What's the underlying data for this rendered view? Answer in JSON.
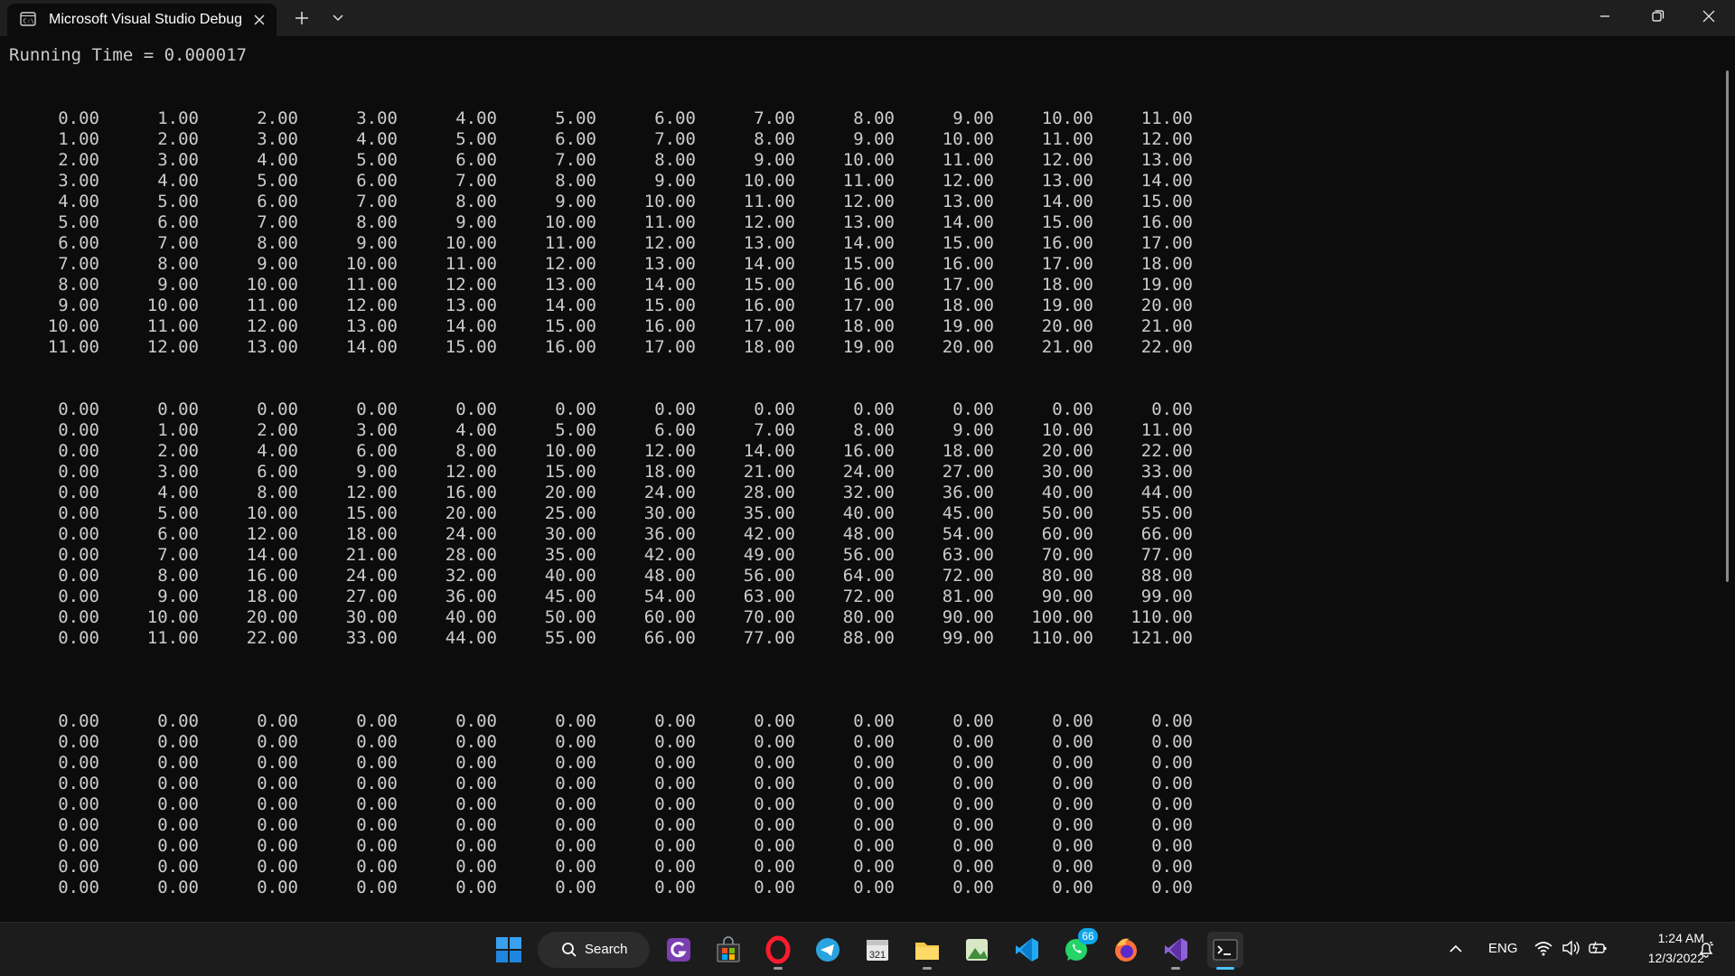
{
  "window": {
    "tab_title": "Microsoft Visual Studio Debug Console",
    "tab_icon": "terminal-icon",
    "buttons": [
      "minimize-icon",
      "restore-icon",
      "close-icon"
    ]
  },
  "console": {
    "running_time": "Running Time = 0.000017",
    "matrices": [
      {
        "rows": [
          [
            "0.00",
            "1.00",
            "2.00",
            "3.00",
            "4.00",
            "5.00",
            "6.00",
            "7.00",
            "8.00",
            "9.00",
            "10.00",
            "11.00"
          ],
          [
            "1.00",
            "2.00",
            "3.00",
            "4.00",
            "5.00",
            "6.00",
            "7.00",
            "8.00",
            "9.00",
            "10.00",
            "11.00",
            "12.00"
          ],
          [
            "2.00",
            "3.00",
            "4.00",
            "5.00",
            "6.00",
            "7.00",
            "8.00",
            "9.00",
            "10.00",
            "11.00",
            "12.00",
            "13.00"
          ],
          [
            "3.00",
            "4.00",
            "5.00",
            "6.00",
            "7.00",
            "8.00",
            "9.00",
            "10.00",
            "11.00",
            "12.00",
            "13.00",
            "14.00"
          ],
          [
            "4.00",
            "5.00",
            "6.00",
            "7.00",
            "8.00",
            "9.00",
            "10.00",
            "11.00",
            "12.00",
            "13.00",
            "14.00",
            "15.00"
          ],
          [
            "5.00",
            "6.00",
            "7.00",
            "8.00",
            "9.00",
            "10.00",
            "11.00",
            "12.00",
            "13.00",
            "14.00",
            "15.00",
            "16.00"
          ],
          [
            "6.00",
            "7.00",
            "8.00",
            "9.00",
            "10.00",
            "11.00",
            "12.00",
            "13.00",
            "14.00",
            "15.00",
            "16.00",
            "17.00"
          ],
          [
            "7.00",
            "8.00",
            "9.00",
            "10.00",
            "11.00",
            "12.00",
            "13.00",
            "14.00",
            "15.00",
            "16.00",
            "17.00",
            "18.00"
          ],
          [
            "8.00",
            "9.00",
            "10.00",
            "11.00",
            "12.00",
            "13.00",
            "14.00",
            "15.00",
            "16.00",
            "17.00",
            "18.00",
            "19.00"
          ],
          [
            "9.00",
            "10.00",
            "11.00",
            "12.00",
            "13.00",
            "14.00",
            "15.00",
            "16.00",
            "17.00",
            "18.00",
            "19.00",
            "20.00"
          ],
          [
            "10.00",
            "11.00",
            "12.00",
            "13.00",
            "14.00",
            "15.00",
            "16.00",
            "17.00",
            "18.00",
            "19.00",
            "20.00",
            "21.00"
          ],
          [
            "11.00",
            "12.00",
            "13.00",
            "14.00",
            "15.00",
            "16.00",
            "17.00",
            "18.00",
            "19.00",
            "20.00",
            "21.00",
            "22.00"
          ]
        ]
      },
      {
        "rows": [
          [
            "0.00",
            "0.00",
            "0.00",
            "0.00",
            "0.00",
            "0.00",
            "0.00",
            "0.00",
            "0.00",
            "0.00",
            "0.00",
            "0.00"
          ],
          [
            "0.00",
            "1.00",
            "2.00",
            "3.00",
            "4.00",
            "5.00",
            "6.00",
            "7.00",
            "8.00",
            "9.00",
            "10.00",
            "11.00"
          ],
          [
            "0.00",
            "2.00",
            "4.00",
            "6.00",
            "8.00",
            "10.00",
            "12.00",
            "14.00",
            "16.00",
            "18.00",
            "20.00",
            "22.00"
          ],
          [
            "0.00",
            "3.00",
            "6.00",
            "9.00",
            "12.00",
            "15.00",
            "18.00",
            "21.00",
            "24.00",
            "27.00",
            "30.00",
            "33.00"
          ],
          [
            "0.00",
            "4.00",
            "8.00",
            "12.00",
            "16.00",
            "20.00",
            "24.00",
            "28.00",
            "32.00",
            "36.00",
            "40.00",
            "44.00"
          ],
          [
            "0.00",
            "5.00",
            "10.00",
            "15.00",
            "20.00",
            "25.00",
            "30.00",
            "35.00",
            "40.00",
            "45.00",
            "50.00",
            "55.00"
          ],
          [
            "0.00",
            "6.00",
            "12.00",
            "18.00",
            "24.00",
            "30.00",
            "36.00",
            "42.00",
            "48.00",
            "54.00",
            "60.00",
            "66.00"
          ],
          [
            "0.00",
            "7.00",
            "14.00",
            "21.00",
            "28.00",
            "35.00",
            "42.00",
            "49.00",
            "56.00",
            "63.00",
            "70.00",
            "77.00"
          ],
          [
            "0.00",
            "8.00",
            "16.00",
            "24.00",
            "32.00",
            "40.00",
            "48.00",
            "56.00",
            "64.00",
            "72.00",
            "80.00",
            "88.00"
          ],
          [
            "0.00",
            "9.00",
            "18.00",
            "27.00",
            "36.00",
            "45.00",
            "54.00",
            "63.00",
            "72.00",
            "81.00",
            "90.00",
            "99.00"
          ],
          [
            "0.00",
            "10.00",
            "20.00",
            "30.00",
            "40.00",
            "50.00",
            "60.00",
            "70.00",
            "80.00",
            "90.00",
            "100.00",
            "110.00"
          ],
          [
            "0.00",
            "11.00",
            "22.00",
            "33.00",
            "44.00",
            "55.00",
            "66.00",
            "77.00",
            "88.00",
            "99.00",
            "110.00",
            "121.00"
          ]
        ]
      },
      {
        "rows": [
          [
            "0.00",
            "0.00",
            "0.00",
            "0.00",
            "0.00",
            "0.00",
            "0.00",
            "0.00",
            "0.00",
            "0.00",
            "0.00",
            "0.00"
          ],
          [
            "0.00",
            "0.00",
            "0.00",
            "0.00",
            "0.00",
            "0.00",
            "0.00",
            "0.00",
            "0.00",
            "0.00",
            "0.00",
            "0.00"
          ],
          [
            "0.00",
            "0.00",
            "0.00",
            "0.00",
            "0.00",
            "0.00",
            "0.00",
            "0.00",
            "0.00",
            "0.00",
            "0.00",
            "0.00"
          ],
          [
            "0.00",
            "0.00",
            "0.00",
            "0.00",
            "0.00",
            "0.00",
            "0.00",
            "0.00",
            "0.00",
            "0.00",
            "0.00",
            "0.00"
          ],
          [
            "0.00",
            "0.00",
            "0.00",
            "0.00",
            "0.00",
            "0.00",
            "0.00",
            "0.00",
            "0.00",
            "0.00",
            "0.00",
            "0.00"
          ],
          [
            "0.00",
            "0.00",
            "0.00",
            "0.00",
            "0.00",
            "0.00",
            "0.00",
            "0.00",
            "0.00",
            "0.00",
            "0.00",
            "0.00"
          ],
          [
            "0.00",
            "0.00",
            "0.00",
            "0.00",
            "0.00",
            "0.00",
            "0.00",
            "0.00",
            "0.00",
            "0.00",
            "0.00",
            "0.00"
          ],
          [
            "0.00",
            "0.00",
            "0.00",
            "0.00",
            "0.00",
            "0.00",
            "0.00",
            "0.00",
            "0.00",
            "0.00",
            "0.00",
            "0.00"
          ],
          [
            "0.00",
            "0.00",
            "0.00",
            "0.00",
            "0.00",
            "0.00",
            "0.00",
            "0.00",
            "0.00",
            "0.00",
            "0.00",
            "0.00"
          ]
        ]
      }
    ]
  },
  "taskbar": {
    "search_label": "Search",
    "whatsapp_badge": "66",
    "language": "ENG",
    "time": "1:24 AM",
    "date": "12/3/2022",
    "apps": [
      "windows-start-icon",
      "search-icon",
      "pdf-app-icon",
      "microsoft-store-icon",
      "opera-icon",
      "telegram-icon",
      "calendar-app-icon",
      "file-explorer-icon",
      "photo-app-icon",
      "vscode-icon",
      "whatsapp-icon",
      "firefox-icon",
      "visual-studio-icon",
      "terminal-icon"
    ],
    "accent_color": "#4cc2ff"
  }
}
